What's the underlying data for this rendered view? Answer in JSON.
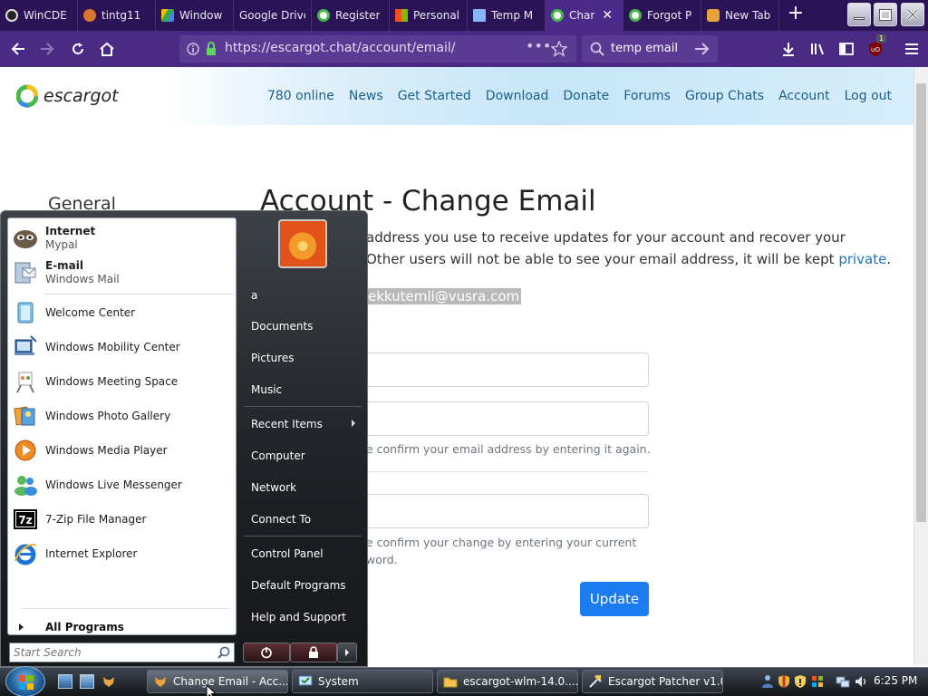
{
  "browser": {
    "tabs": [
      {
        "title": "WinCDE",
        "icon": "gear-icon",
        "color": "#222222"
      },
      {
        "title": "tintg11",
        "icon": "smiley-icon",
        "color": "#d9762b"
      },
      {
        "title": "Window",
        "icon": "google-drive-icon",
        "color": "#34a853"
      },
      {
        "title": "Google Drive",
        "icon": "google-drive-icon",
        "color": "#fbbc04"
      },
      {
        "title": "Register",
        "icon": "escargot-icon",
        "color": "#48b84a"
      },
      {
        "title": "Personal",
        "icon": "microsoft-icon",
        "color": "#f25022"
      },
      {
        "title": "Temp M",
        "icon": "mail-icon",
        "color": "#8ab4f8"
      },
      {
        "title": "Char",
        "icon": "escargot-icon",
        "color": "#48b84a"
      },
      {
        "title": "Forgot P",
        "icon": "escargot-icon",
        "color": "#48b84a"
      },
      {
        "title": "New Tab",
        "icon": "fox-icon",
        "color": "#e8a33d"
      }
    ],
    "active_tab_close": "✕",
    "new_tab": "+",
    "url": "https://escargot.chat/account/email/",
    "search_text": "temp email",
    "ublock_badge": "1"
  },
  "site": {
    "logo_text": "escargot",
    "nav": [
      "780 online",
      "News",
      "Get Started",
      "Download",
      "Donate",
      "Forums",
      "Group Chats",
      "Account",
      "Log out"
    ],
    "side_heading": "General",
    "title": "Account - Change Email",
    "para_line1": "address you use to receive updates for your account and recover your",
    "para_line2": "Other users will not be able to see your email address, it will be kept ",
    "para_link": "private",
    "para_end": ".",
    "current_email": "ekkutemli@vusra.com",
    "help_confirm_email": "e confirm your email address by entering it again.",
    "help_confirm_change_1": "e confirm your change by entering your current",
    "help_confirm_change_2": "word.",
    "update_button": "Update"
  },
  "start_menu": {
    "pinned": [
      {
        "title": "Internet",
        "subtitle": "Mypal",
        "icon": "mypal-icon"
      },
      {
        "title": "E-mail",
        "subtitle": "Windows Mail",
        "icon": "windows-mail-icon"
      }
    ],
    "recent": [
      {
        "title": "Welcome Center",
        "icon": "welcome-center-icon"
      },
      {
        "title": "Windows Mobility Center",
        "icon": "mobility-center-icon"
      },
      {
        "title": "Windows Meeting Space",
        "icon": "meeting-space-icon"
      },
      {
        "title": "Windows Photo Gallery",
        "icon": "photo-gallery-icon"
      },
      {
        "title": "Windows Media Player",
        "icon": "media-player-icon"
      },
      {
        "title": "Windows Live Messenger",
        "icon": "messenger-icon"
      },
      {
        "title": "7-Zip File Manager",
        "icon": "7zip-icon"
      },
      {
        "title": "Internet Explorer",
        "icon": "internet-explorer-icon"
      }
    ],
    "all_programs": "All Programs",
    "search_placeholder": "Start Search",
    "right": {
      "user": "a",
      "documents": "Documents",
      "pictures": "Pictures",
      "music": "Music",
      "recent_items": "Recent Items",
      "computer": "Computer",
      "network": "Network",
      "connect_to": "Connect To",
      "control_panel": "Control Panel",
      "default_programs": "Default Programs",
      "help_support": "Help and Support"
    }
  },
  "taskbar": {
    "tasks": [
      {
        "label": "Change Email - Acc...",
        "icon": "fox-icon",
        "active": true
      },
      {
        "label": "System",
        "icon": "system-icon",
        "active": false
      },
      {
        "label": "escargot-wlm-14.0....",
        "icon": "folder-icon",
        "active": false
      },
      {
        "label": "Escargot Patcher v1.0",
        "icon": "patcher-icon",
        "active": false
      }
    ],
    "time": "6:25 PM"
  },
  "colors": {
    "tabstrip": "#2a1357",
    "navbar": "#4a2a84",
    "link": "#1a73c8",
    "update_button": "#1a7cf0",
    "site_nav": "#1d5f8b"
  }
}
